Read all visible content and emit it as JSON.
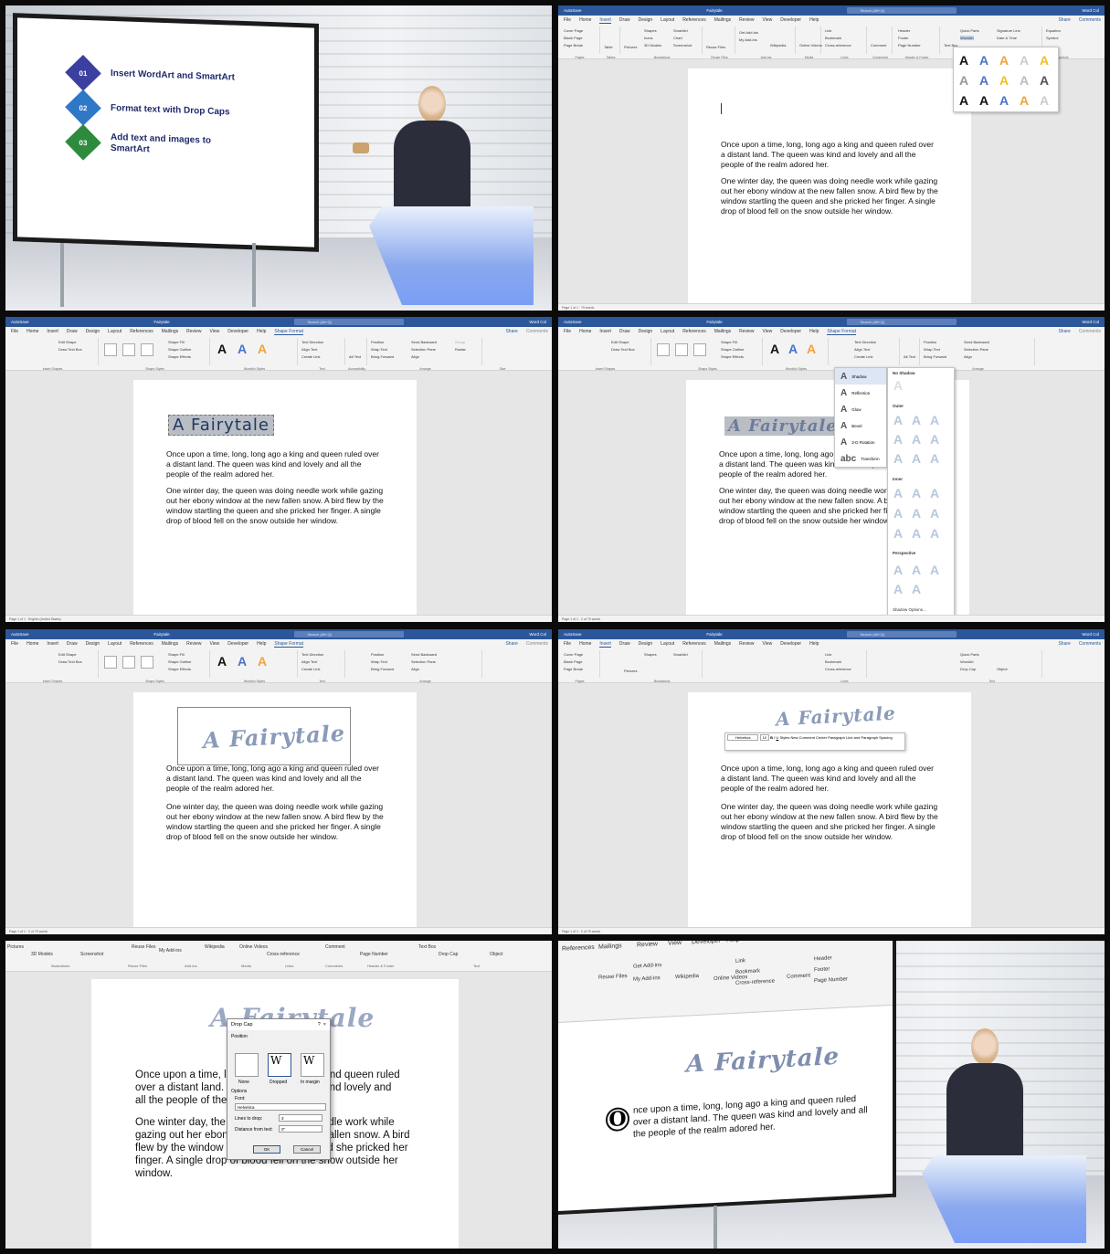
{
  "agenda": [
    {
      "num": "01",
      "text": "Insert WordArt and SmartArt",
      "color": "#3b3fa0"
    },
    {
      "num": "02",
      "text": "Format text with Drop Caps",
      "color": "#2e78c6"
    },
    {
      "num": "03",
      "text": "Add text and images to SmartArt",
      "color": "#2e8b3d"
    }
  ],
  "word": {
    "title": "Fairytale",
    "search": "Search (Alt+Q)",
    "user": "Word Col",
    "menu_insert": [
      "File",
      "Home",
      "Insert",
      "Draw",
      "Design",
      "Layout",
      "References",
      "Mailings",
      "Review",
      "View",
      "Developer",
      "Help"
    ],
    "menu_shape": [
      "File",
      "Home",
      "Insert",
      "Draw",
      "Design",
      "Layout",
      "References",
      "Mailings",
      "Review",
      "View",
      "Developer",
      "Help",
      "Shape Format"
    ],
    "share": "Share",
    "comments": "Comments",
    "ribbon_insert": [
      "Cover Page",
      "Blank Page",
      "Page Break",
      "Table",
      "Pictures",
      "Shapes",
      "Icons",
      "3D Models",
      "SmartArt",
      "Chart",
      "Screenshot",
      "Reuse Files",
      "Get Add-ins",
      "My Add-ins",
      "Wikipedia",
      "Online Videos",
      "Link",
      "Bookmark",
      "Cross-reference",
      "Comment",
      "Header",
      "Footer",
      "Page Number",
      "Text Box",
      "Quick Parts",
      "WordArt",
      "Drop Cap",
      "Signature Line",
      "Date & Time",
      "Object",
      "Equation",
      "Symbol"
    ],
    "ribbon_insert_groups": [
      "Pages",
      "Tables",
      "Illustrations",
      "Reuse Files",
      "Add-ins",
      "Media",
      "Links",
      "Comments",
      "Header & Footer",
      "Text",
      "Symbols"
    ],
    "ribbon_shape": [
      "Edit Shape",
      "Draw Text Box",
      "Shape Fill",
      "Shape Outline",
      "Shape Effects",
      "Text Direction",
      "Align Text",
      "Create Link",
      "Alt Text",
      "Position",
      "Wrap Text",
      "Bring Forward",
      "Send Backward",
      "Selection Pane",
      "Align",
      "Group",
      "Rotate"
    ],
    "ribbon_shape_groups": [
      "Insert Shapes",
      "Shape Styles",
      "WordArt Styles",
      "Text",
      "Accessibility",
      "Arrange",
      "Size"
    ],
    "status_left": "Page 1 of 1",
    "status_words": "79 words",
    "status_words2": "2 of 79 words",
    "status_lang": "English (United States)",
    "status_right": "Display Settings",
    "zoom": "100%"
  },
  "doc": {
    "para1": "Once upon a time, long, long ago a king and queen ruled over a distant land.  The queen was kind and lovely and all the people of the realm adored her.",
    "para2": "One winter day, the queen was doing needle work while gazing out her ebony window at the new fallen snow.  A bird flew by the window startling the queen and she pricked her finger.  A single drop of blood fell on the snow outside her window.",
    "wordart": "A Fairytale",
    "dropcap_rest": "nce upon a time, long, long ago a king and queen ruled over a distant land.  The queen was kind and lovely and all the people of the realm adored her.",
    "dropcap_letter": "O"
  },
  "shadow_menu": {
    "items": [
      "Shadow",
      "Reflection",
      "Glow",
      "Bevel",
      "3-D Rotation",
      "Transform"
    ],
    "no_shadow": "No Shadow",
    "outer": "Outer",
    "inner": "Inner",
    "perspective": "Perspective",
    "options": "Shadow Options..."
  },
  "minitoolbar": {
    "font": "Helvetica",
    "size": "10",
    "labels": [
      "Styles",
      "New Comment",
      "Center",
      "Paragraph",
      "Line and Paragraph Spacing"
    ]
  },
  "dropcap_dialog": {
    "title": "Drop Cap",
    "position": "Position",
    "none": "None",
    "dropped": "Dropped",
    "in_margin": "In margin",
    "options": "Options",
    "font_label": "Font:",
    "font_value": "Helvetica",
    "lines_label": "Lines to drop:",
    "lines_value": "3",
    "distance_label": "Distance from text:",
    "distance_value": "0\"",
    "ok": "OK",
    "cancel": "Cancel",
    "help": "?",
    "close": "×"
  },
  "zoomed_ribbon": [
    "Pictures",
    "3D Models",
    "Screenshot",
    "Reuse Files",
    "My Add-ins",
    "Wikipedia",
    "Online Videos",
    "Cross-reference",
    "Comment",
    "Page Number",
    "Text Box",
    "Drop Cap",
    "Object"
  ],
  "zoomed_ribbon_groups": [
    "Illustrations",
    "Reuse Files",
    "Add-ins",
    "Media",
    "Links",
    "Comments",
    "Header & Footer",
    "Text"
  ],
  "colors": {
    "word_blue": "#2b579a",
    "wordart_gray": "#8a9ab8"
  }
}
